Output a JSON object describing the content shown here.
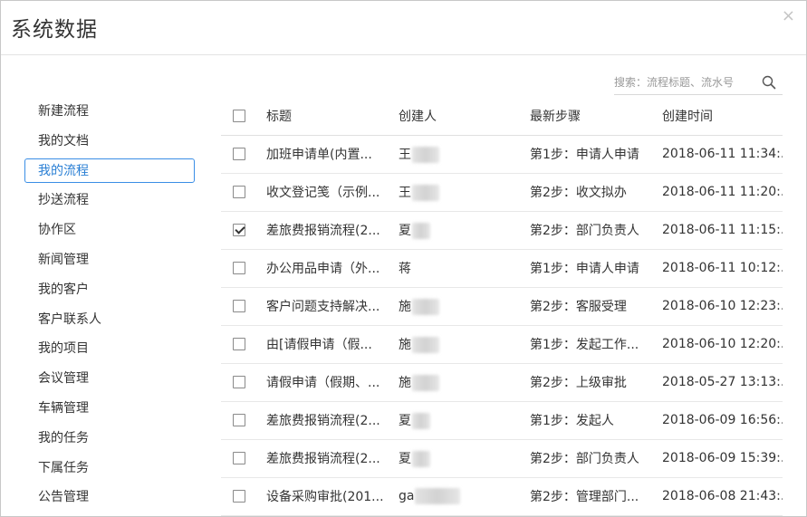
{
  "dialog": {
    "title": "系统数据",
    "close_glyph": "×"
  },
  "sidebar": {
    "items": [
      {
        "label": "新建流程",
        "active": false
      },
      {
        "label": "我的文档",
        "active": false
      },
      {
        "label": "我的流程",
        "active": true
      },
      {
        "label": "抄送流程",
        "active": false
      },
      {
        "label": "协作区",
        "active": false
      },
      {
        "label": "新闻管理",
        "active": false
      },
      {
        "label": "我的客户",
        "active": false
      },
      {
        "label": "客户联系人",
        "active": false
      },
      {
        "label": "我的项目",
        "active": false
      },
      {
        "label": "会议管理",
        "active": false
      },
      {
        "label": "车辆管理",
        "active": false
      },
      {
        "label": "我的任务",
        "active": false
      },
      {
        "label": "下属任务",
        "active": false
      },
      {
        "label": "公告管理",
        "active": false
      }
    ]
  },
  "search": {
    "placeholder": "搜索：流程标题、流水号",
    "value": ""
  },
  "table": {
    "headers": {
      "title": "标题",
      "creator": "创建人",
      "step": "最新步骤",
      "time": "创建时间"
    },
    "rows": [
      {
        "checked": false,
        "title": "加班申请单(内置...",
        "creator": "王",
        "step": "第1步：申请人申请",
        "time": "2018-06-11 11:34:..."
      },
      {
        "checked": false,
        "title": "收文登记笺（示例...",
        "creator": "王",
        "step": "第2步：收文拟办",
        "time": "2018-06-11 11:20:..."
      },
      {
        "checked": true,
        "title": "差旅费报销流程(2...",
        "creator": "夏",
        "step": "第2步：部门负责人",
        "time": "2018-06-11 11:15:..."
      },
      {
        "checked": false,
        "title": "办公用品申请（外...",
        "creator": "蒋",
        "step": "第1步：申请人申请",
        "time": "2018-06-11 10:12:..."
      },
      {
        "checked": false,
        "title": "客户问题支持解决...",
        "creator": "施",
        "step": "第2步：客服受理",
        "time": "2018-06-10 12:23:..."
      },
      {
        "checked": false,
        "title": "由[请假申请（假...",
        "creator": "施",
        "step": "第1步：发起工作...",
        "time": "2018-06-10 12:20:..."
      },
      {
        "checked": false,
        "title": "请假申请（假期、...",
        "creator": "施",
        "step": "第2步：上级审批",
        "time": "2018-05-27 13:13:..."
      },
      {
        "checked": false,
        "title": "差旅费报销流程(2...",
        "creator": "夏",
        "step": "第1步：发起人",
        "time": "2018-06-09 16:56:..."
      },
      {
        "checked": false,
        "title": "差旅费报销流程(2...",
        "creator": "夏",
        "step": "第2步：部门负责人",
        "time": "2018-06-09 15:39:..."
      },
      {
        "checked": false,
        "title": "设备采购审批(201...",
        "creator": "ga",
        "step": "第2步：管理部门...",
        "time": "2018-06-08 21:43:..."
      }
    ]
  },
  "colors": {
    "accent": "#3a8ee6",
    "border": "#e8e8e8",
    "text": "#333333",
    "muted": "#999999"
  }
}
